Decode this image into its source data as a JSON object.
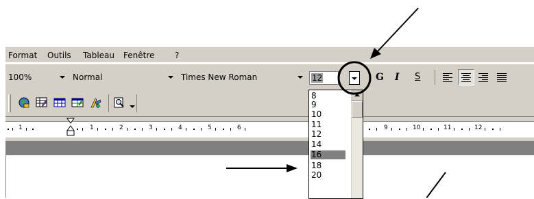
{
  "menu": {
    "items": [
      {
        "label": "Format"
      },
      {
        "label": "Outils"
      },
      {
        "label": "Tableau"
      },
      {
        "label": "Fenêtre"
      },
      {
        "label": "?"
      }
    ]
  },
  "format_toolbar": {
    "zoom": "100%",
    "style": "Normal",
    "font": "Times New Roman",
    "size": "12",
    "bold_label": "G",
    "italic_label": "I",
    "underline_label": "S"
  },
  "ruler": {
    "labels": [
      "1",
      "1",
      "2",
      "3",
      "4",
      "5",
      "6",
      "9",
      "10",
      "11",
      "12"
    ]
  },
  "font_size_list": {
    "items": [
      "8",
      "9",
      "10",
      "11",
      "12",
      "14",
      "16",
      "18",
      "20"
    ],
    "highlighted": "16"
  },
  "annotation": {
    "color": "#000000"
  }
}
